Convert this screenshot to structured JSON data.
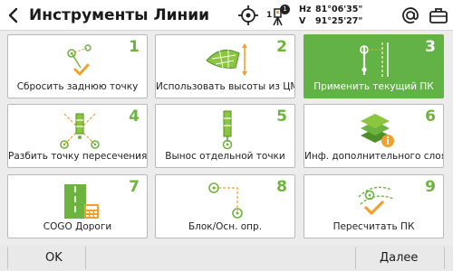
{
  "header": {
    "title": "Инструменты Линии",
    "back_icon": "chevron-left-icon",
    "instrument_number": "1",
    "instrument_badge": "1",
    "hz_label": "Hz",
    "hz_value": "81°06'35\"",
    "v_label": "V",
    "v_value": "91°25'27\""
  },
  "tiles": [
    {
      "number": "1",
      "label": "Сбросить заднюю точку",
      "icon": "reset-backsight-icon"
    },
    {
      "number": "2",
      "label": "Использовать высоты из ЦМР",
      "icon": "dtm-heights-icon"
    },
    {
      "number": "3",
      "label": "Применить текущий ПК",
      "icon": "apply-chainage-icon",
      "selected": true
    },
    {
      "number": "4",
      "label": "Разбить точку пересечения",
      "icon": "intersection-stakeout-icon"
    },
    {
      "number": "5",
      "label": "Вынос отдельной точки",
      "icon": "single-point-stakeout-icon"
    },
    {
      "number": "6",
      "label": "Инф. дополнительного слоя",
      "icon": "layer-info-icon"
    },
    {
      "number": "7",
      "label": "COGO Дороги",
      "icon": "road-cogo-icon"
    },
    {
      "number": "8",
      "label": "Блок/Осн. опр.",
      "icon": "block-reference-icon"
    },
    {
      "number": "9",
      "label": "Пересчитать ПК",
      "icon": "recompute-chainage-icon"
    }
  ],
  "footer": {
    "ok_label": "OK",
    "next_label": "Далее"
  },
  "colors": {
    "accent_green": "#63b246",
    "number_green": "#6db33f",
    "warning_orange": "#f0a02c"
  }
}
